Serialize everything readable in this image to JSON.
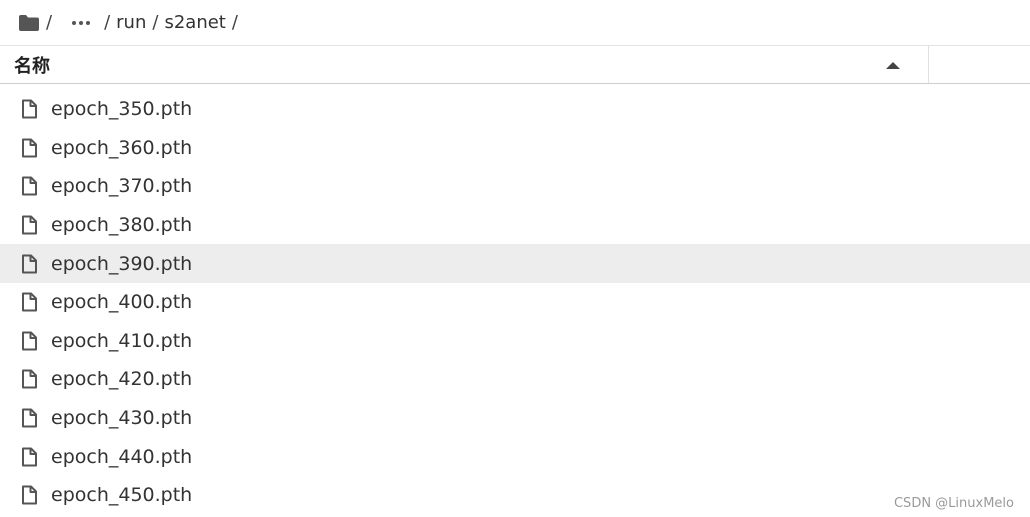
{
  "breadcrumb": {
    "separator": "/",
    "items": [
      "run",
      "s2anet"
    ]
  },
  "table": {
    "name_header": "名称",
    "sort_direction": "ascending"
  },
  "files": [
    {
      "name": "epoch_350.pth"
    },
    {
      "name": "epoch_360.pth"
    },
    {
      "name": "epoch_370.pth"
    },
    {
      "name": "epoch_380.pth"
    },
    {
      "name": "epoch_390.pth",
      "highlighted": true
    },
    {
      "name": "epoch_400.pth"
    },
    {
      "name": "epoch_410.pth"
    },
    {
      "name": "epoch_420.pth"
    },
    {
      "name": "epoch_430.pth"
    },
    {
      "name": "epoch_440.pth"
    },
    {
      "name": "epoch_450.pth"
    }
  ],
  "watermark": "CSDN @LinuxMelo",
  "colors": {
    "hover_row": "#ededed",
    "icon": "#555555"
  }
}
